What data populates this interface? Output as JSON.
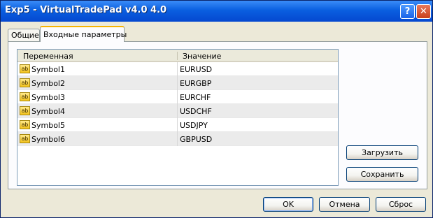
{
  "window": {
    "title": "Exp5 - VirtualTradePad v4.0 4.0"
  },
  "titlebar": {
    "help_glyph": "?",
    "close_glyph": "✕"
  },
  "tabs": [
    {
      "label": "Общие",
      "active": false
    },
    {
      "label": "Входные параметры",
      "active": true
    }
  ],
  "grid": {
    "columns": [
      "Переменная",
      "Значение"
    ],
    "type_icon_text": "ab",
    "rows": [
      {
        "variable": "Symbol1",
        "value": "EURUSD"
      },
      {
        "variable": "Symbol2",
        "value": "EURGBP"
      },
      {
        "variable": "Symbol3",
        "value": "EURCHF"
      },
      {
        "variable": "Symbol4",
        "value": "USDCHF"
      },
      {
        "variable": "Symbol5",
        "value": "USDJPY"
      },
      {
        "variable": "Symbol6",
        "value": "GBPUSD"
      }
    ]
  },
  "side_buttons": {
    "load": "Загрузить",
    "save": "Сохранить"
  },
  "footer": {
    "ok": "OK",
    "cancel": "Отмена",
    "reset": "Сброс"
  }
}
